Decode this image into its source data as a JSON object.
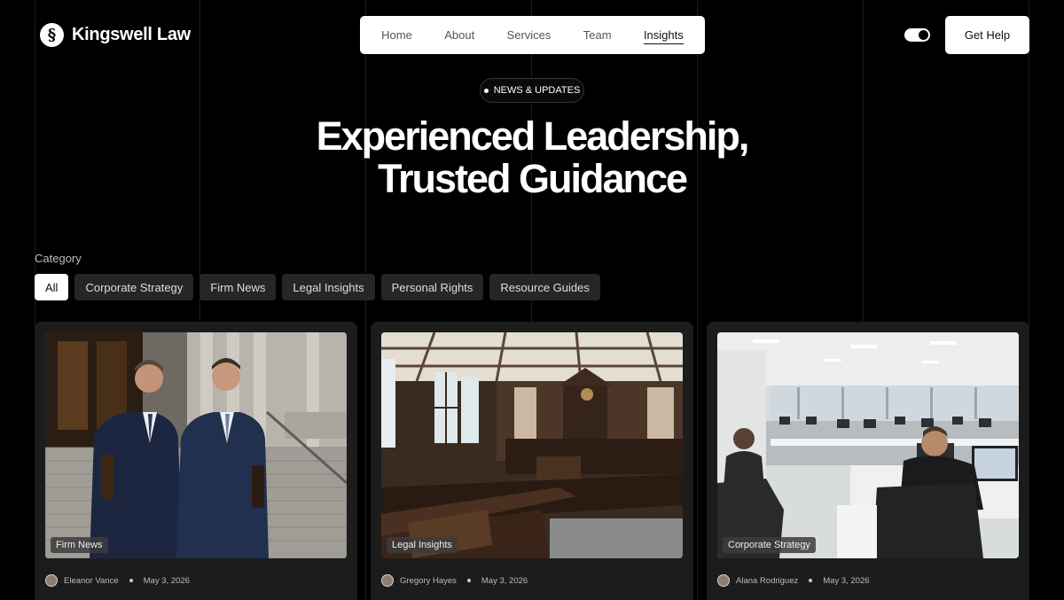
{
  "brand": {
    "name": "Kingswell Law",
    "logo_glyph": "§"
  },
  "nav": {
    "items": [
      {
        "label": "Home"
      },
      {
        "label": "About"
      },
      {
        "label": "Services"
      },
      {
        "label": "Team"
      },
      {
        "label": "Insights",
        "active": true
      }
    ]
  },
  "header": {
    "theme_toggle": "on",
    "cta_label": "Get Help"
  },
  "hero": {
    "badge": "NEWS & UPDATES",
    "title_line1": "Experienced Leadership,",
    "title_line2": "Trusted Guidance"
  },
  "category": {
    "label": "Category",
    "chips": [
      {
        "label": "All",
        "active": true
      },
      {
        "label": "Corporate Strategy"
      },
      {
        "label": "Firm News"
      },
      {
        "label": "Legal Insights"
      },
      {
        "label": "Personal Rights"
      },
      {
        "label": "Resource Guides"
      }
    ]
  },
  "cards": [
    {
      "tag": "Firm News",
      "author": "Eleanor Vance",
      "date": "May 3, 2026",
      "image": "two-lawyers-on-courthouse-steps"
    },
    {
      "tag": "Legal Insights",
      "author": "Gregory Hayes",
      "date": "May 3, 2026",
      "image": "wood-paneled-courtroom"
    },
    {
      "tag": "Corporate Strategy",
      "author": "Alana Rodriguez",
      "date": "May 3, 2026",
      "image": "open-plan-office"
    }
  ],
  "colors": {
    "background": "#000000",
    "surface": "#1c1c1c",
    "chip": "#262626",
    "accent": "#ffffff"
  }
}
